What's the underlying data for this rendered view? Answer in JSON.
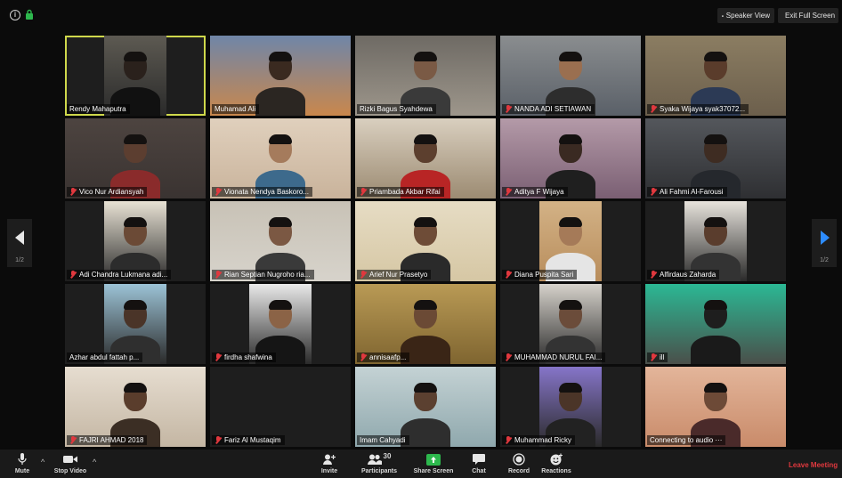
{
  "top": {
    "speaker_view": "Speaker View",
    "exit_full_screen": "Exit Full Screen"
  },
  "participants": [
    {
      "name": "Rendy Mahaputra",
      "muted": false,
      "active": true,
      "bg": "#2a2a2a",
      "wall": "#5d5a52",
      "skin": "#2a211c",
      "shirt": "#111111"
    },
    {
      "name": "Muhamad Ali",
      "muted": false,
      "active": false,
      "bg": "#c9874c",
      "wall": "#6f86a8",
      "skin": "#3a2a20",
      "shirt": "#2b2622"
    },
    {
      "name": "Rizki Bagus Syahdewa",
      "muted": false,
      "active": false,
      "bg": "#9d968b",
      "wall": "#6e6a64",
      "skin": "#7a5a45",
      "shirt": "#3a3a3a"
    },
    {
      "name": "NANDA ADI SETIAWAN",
      "muted": true,
      "active": false,
      "bg": "#5a6068",
      "wall": "#8a8d8f",
      "skin": "#9a6f50",
      "shirt": "#2d2d2d"
    },
    {
      "name": "Syaka Wijaya syak37072...",
      "muted": true,
      "active": false,
      "bg": "#6c5f4c",
      "wall": "#8b7d62",
      "skin": "#5a3c2b",
      "shirt": "#2c3a55"
    },
    {
      "name": "Vico Nur Ardiansyah",
      "muted": true,
      "active": false,
      "bg": "#3a3331",
      "wall": "#4d4440",
      "skin": "#5c3e30",
      "shirt": "#8a2b2b"
    },
    {
      "name": "Vionata Nendya Baskoro...",
      "muted": true,
      "active": false,
      "bg": "#c9b39b",
      "wall": "#e0d0bd",
      "skin": "#a57b5c",
      "shirt": "#3d6a8c"
    },
    {
      "name": "Priambada Akbar Rifai",
      "muted": true,
      "active": false,
      "bg": "#9c8b72",
      "wall": "#d9cfbf",
      "skin": "#5c3f2e",
      "shirt": "#b82525"
    },
    {
      "name": "Aditya F Wijaya",
      "muted": true,
      "active": false,
      "bg": "#7a5f73",
      "wall": "#b49aa8",
      "skin": "#3a2a22",
      "shirt": "#1f1f1f"
    },
    {
      "name": "Ali Fahmi Al-Farousi",
      "muted": true,
      "active": false,
      "bg": "#2e2f32",
      "wall": "#54575c",
      "skin": "#3e2c22",
      "shirt": "#25282d"
    },
    {
      "name": "Adi Chandra Lukmana adi...",
      "muted": true,
      "active": false,
      "bg": "#2b2b2b",
      "wall": "#e8e2d4",
      "skin": "#6b4a36",
      "shirt": "#2c2c2c"
    },
    {
      "name": "Rian Septian Nugroho ria...",
      "muted": true,
      "active": false,
      "bg": "#d7d3cb",
      "wall": "#c8c2b6",
      "skin": "#7b5843",
      "shirt": "#3a3a3a"
    },
    {
      "name": "Arief Nur Prasetyo",
      "muted": true,
      "active": false,
      "bg": "#d6c7a4",
      "wall": "#e6dcc4",
      "skin": "#6e4c37",
      "shirt": "#2a2a2a"
    },
    {
      "name": "Diana Puspita Sari",
      "muted": true,
      "active": false,
      "bg": "#b88d5c",
      "wall": "#d3b286",
      "skin": "#a57a58",
      "shirt": "#e5e5e5"
    },
    {
      "name": "Alfirdaus Zaharda",
      "muted": true,
      "active": false,
      "bg": "#2a2a2a",
      "wall": "#e7e3dc",
      "skin": "#5a3d2d",
      "shirt": "#333333"
    },
    {
      "name": "Azhar abdul fattah p...",
      "muted": false,
      "active": false,
      "bg": "#2a2a2a",
      "wall": "#9cc3d6",
      "skin": "#4a3428",
      "shirt": "#2f2f2f"
    },
    {
      "name": "firdha shafwina",
      "muted": true,
      "active": false,
      "bg": "#2a2a2a",
      "wall": "#e9e9e9",
      "skin": "#8b6346",
      "shirt": "#151515"
    },
    {
      "name": "annisaafp...",
      "muted": true,
      "active": false,
      "bg": "#7f6530",
      "wall": "#b99a55",
      "skin": "#6b4a35",
      "shirt": "#3a2516"
    },
    {
      "name": "MUHAMMAD NURUL FAI...",
      "muted": true,
      "active": false,
      "bg": "#2a2a2a",
      "wall": "#d6d2cb",
      "skin": "#6b4c3a",
      "shirt": "#333333"
    },
    {
      "name": "ill",
      "muted": true,
      "active": false,
      "bg": "#4a4f4a",
      "wall": "#2bb894",
      "skin": "#1e1e1e",
      "shirt": "#1a1a1a"
    },
    {
      "name": "FAJRI AHMAD 2018",
      "muted": true,
      "active": false,
      "bg": "#c4b6a3",
      "wall": "#e6ddd0",
      "skin": "#5a3d2c",
      "shirt": "#3b2e24"
    },
    {
      "name": "Fariz Al Mustaqim",
      "muted": true,
      "active": false,
      "bg": "#1e1e1e",
      "wall": "#1e1e1e",
      "skin": "#1e1e1e",
      "shirt": "#1e1e1e"
    },
    {
      "name": "Imam Cahyadi",
      "muted": false,
      "active": false,
      "bg": "#8fa8ad",
      "wall": "#c4d2d4",
      "skin": "#5b4030",
      "shirt": "#2e2e2e"
    },
    {
      "name": "Muhammad Ricky",
      "muted": true,
      "active": false,
      "bg": "#2a2a2a",
      "wall": "#8675c9",
      "skin": "#4b3528",
      "shirt": "#222222"
    },
    {
      "name": "Connecting to audio ···",
      "muted": false,
      "active": false,
      "bg": "#c98b6a",
      "wall": "#e3b59a",
      "skin": "#6d4a37",
      "shirt": "#4a2a2a"
    }
  ],
  "nav": {
    "left_page": "1/2",
    "right_page": "1/2"
  },
  "toolbar": {
    "mute": "Mute",
    "stop_video": "Stop Video",
    "invite": "Invite",
    "participants": "Participants",
    "participants_count": "30",
    "share_screen": "Share Screen",
    "chat": "Chat",
    "record": "Record",
    "reactions": "Reactions",
    "leave": "Leave Meeting"
  },
  "colors": {
    "active_speaker": "#cfd84b",
    "muted": "#e0383e",
    "share": "#2db84d",
    "leave": "#e0383e",
    "accent": "#2d8cff"
  }
}
